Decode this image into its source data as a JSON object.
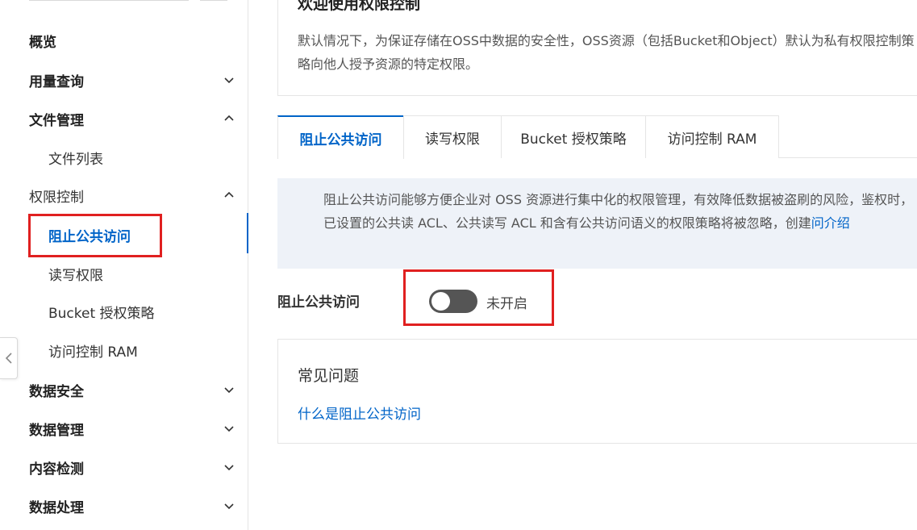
{
  "sidebar": {
    "items": [
      {
        "label": "概览",
        "type": "plain-bold"
      },
      {
        "label": "用量查询",
        "type": "group",
        "expanded": false
      },
      {
        "label": "文件管理",
        "type": "group",
        "expanded": true
      },
      {
        "label": "文件列表",
        "type": "sub"
      },
      {
        "label": "权限控制",
        "type": "group-normal",
        "expanded": true
      },
      {
        "label": "阻止公共访问",
        "type": "sub-active"
      },
      {
        "label": "读写权限",
        "type": "sub"
      },
      {
        "label": "Bucket 授权策略",
        "type": "sub"
      },
      {
        "label": "访问控制 RAM",
        "type": "sub"
      },
      {
        "label": "数据安全",
        "type": "group",
        "expanded": false
      },
      {
        "label": "数据管理",
        "type": "group",
        "expanded": false
      },
      {
        "label": "内容检测",
        "type": "group",
        "expanded": false
      },
      {
        "label": "数据处理",
        "type": "group",
        "expanded": false
      }
    ]
  },
  "welcome": {
    "title": "欢迎使用权限控制",
    "desc": "默认情况下，为保证存储在OSS中数据的安全性，OSS资源（包括Bucket和Object）默认为私有权限控制策略向他人授予资源的特定权限。"
  },
  "tabs": [
    {
      "label": "阻止公共访问",
      "active": true
    },
    {
      "label": "读写权限",
      "active": false
    },
    {
      "label": "Bucket 授权策略",
      "active": false
    },
    {
      "label": "访问控制 RAM",
      "active": false
    }
  ],
  "info": {
    "text": "阻止公共访问能够方便企业对 OSS 资源进行集中化的权限管理，有效降低数据被盗刷的风险，鉴权时，已设置的公共读 ACL、公共读写 ACL 和含有公共访问语义的权限策略将被忽略，创建",
    "link": "问介绍"
  },
  "setting": {
    "label": "阻止公共访问",
    "toggle_on": false,
    "state_text": "未开启"
  },
  "faq": {
    "title": "常见问题",
    "link": "什么是阻止公共访问"
  },
  "colors": {
    "accent": "#0064c8",
    "highlight": "#e02020",
    "toggle_off": "#555555"
  }
}
